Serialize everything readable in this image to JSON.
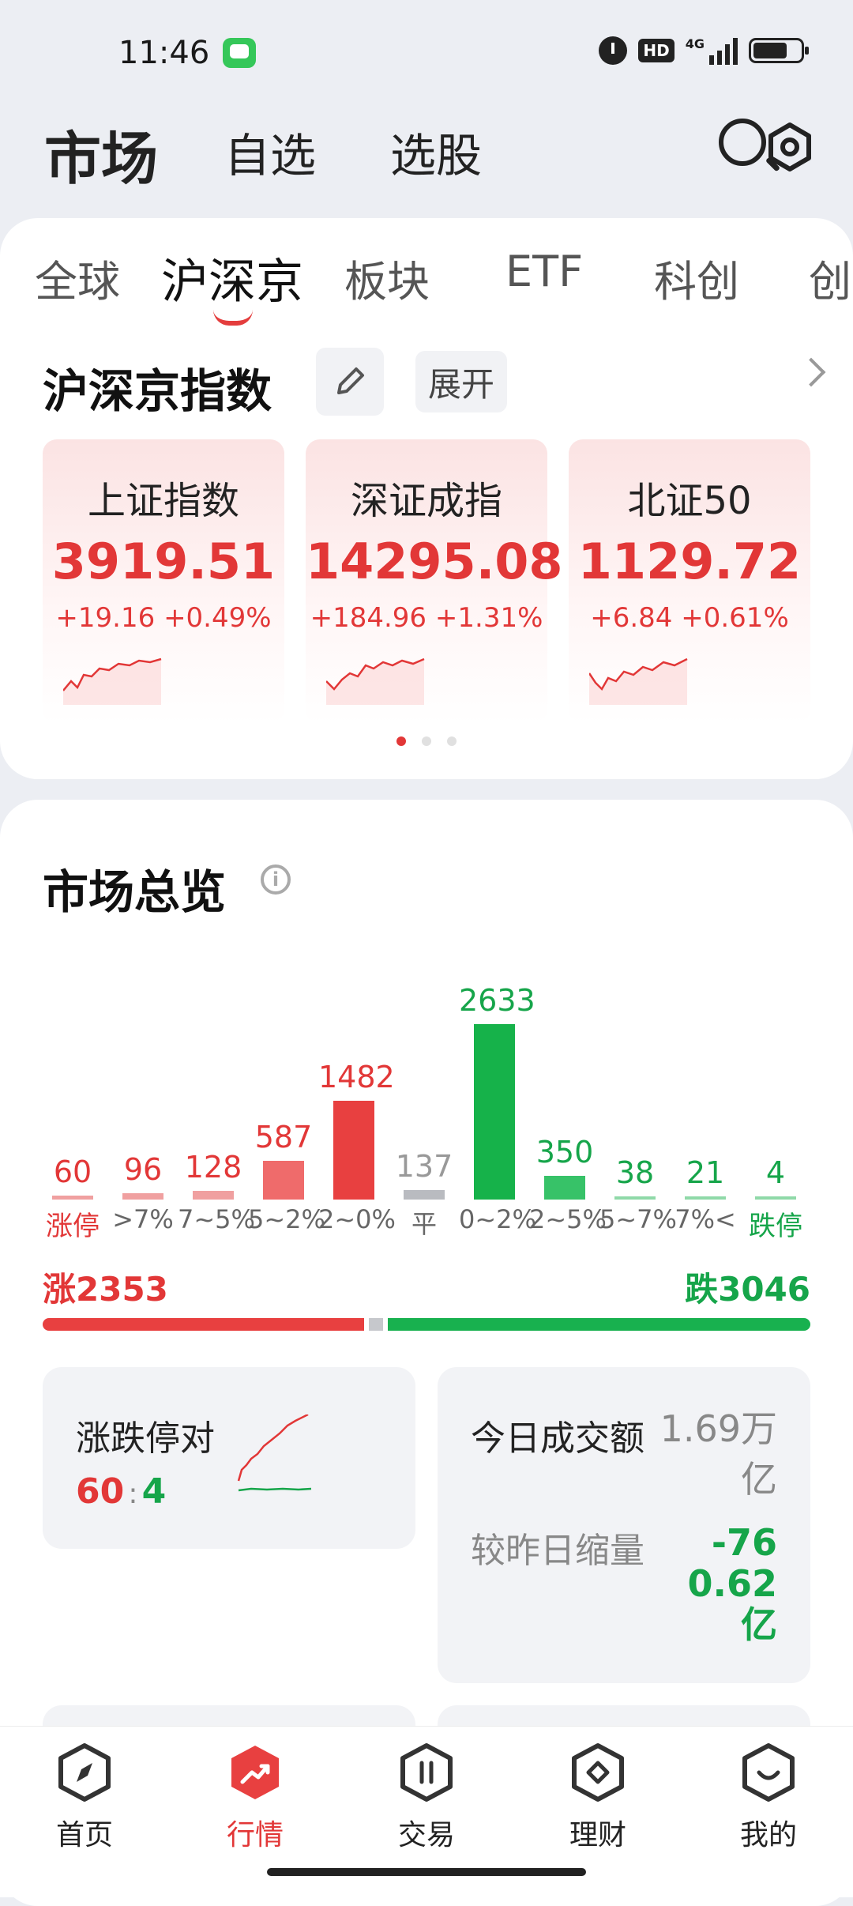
{
  "status_bar": {
    "time": "11:46",
    "hd": "HD",
    "network": "4G"
  },
  "header": {
    "tabs": [
      "市场",
      "自选",
      "选股"
    ],
    "active": "市场"
  },
  "sub_tabs": {
    "items": [
      "全球",
      "沪深京",
      "板块",
      "ETF",
      "科创",
      "创"
    ],
    "active": "沪深京"
  },
  "index_section": {
    "title": "沪深京指数",
    "expand_label": "展开",
    "cards": [
      {
        "name": "上证指数",
        "value": "3919.51",
        "change": "+19.16",
        "pct": "+0.49%"
      },
      {
        "name": "深证成指",
        "value": "14295.08",
        "change": "+184.96",
        "pct": "+1.31%"
      },
      {
        "name": "北证50",
        "value": "1129.72",
        "change": "+6.84",
        "pct": "+0.61%"
      }
    ]
  },
  "overview": {
    "title": "市场总览",
    "rise_label": "涨2353",
    "fall_label": "跌3046",
    "limit_title": "涨跌停对",
    "limit_up": "60",
    "limit_sep": ":",
    "limit_down": "4",
    "turnover_title": "今日成交额",
    "turnover_value": "1.69万\n亿",
    "shrink_label": "较昨日缩量",
    "shrink_value": "-76\n0.62\n亿"
  },
  "chart_data": {
    "type": "bar",
    "categories": [
      "涨停",
      ">7%",
      "7~5%",
      "5~2%",
      "2~0%",
      "平",
      "0~2%",
      "2~5%",
      "5~7%",
      "7%<",
      "跌停"
    ],
    "values": [
      60,
      96,
      128,
      587,
      1482,
      137,
      2633,
      350,
      38,
      21,
      4
    ],
    "colors": {
      "rise": "#e84040",
      "rise_light": "#f0a0a0",
      "flat": "#b9bbc0",
      "fall": "#16b24a",
      "fall_light": "#8fd9a8",
      "rise_text": "#e23737",
      "fall_text": "#16a54a",
      "flat_text": "#999999"
    }
  },
  "nav": {
    "items": [
      "首页",
      "行情",
      "交易",
      "理财",
      "我的"
    ],
    "active": "行情"
  }
}
